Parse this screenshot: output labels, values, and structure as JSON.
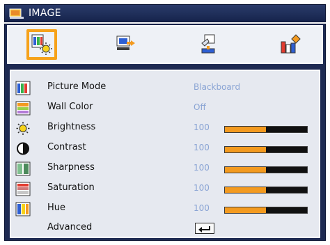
{
  "title": "IMAGE",
  "tabs": [
    {
      "icon": "image-settings-icon",
      "selected": true
    },
    {
      "icon": "display-settings-icon",
      "selected": false
    },
    {
      "icon": "setup-icon",
      "selected": false
    },
    {
      "icon": "options-icon",
      "selected": false
    }
  ],
  "rows": [
    {
      "label": "Picture Mode",
      "value": "Blackboard",
      "icon": "picture-mode-icon"
    },
    {
      "label": "Wall Color",
      "value": "Off",
      "icon": "wall-color-icon"
    },
    {
      "label": "Brightness",
      "value": "100",
      "level": 0.5,
      "icon": "brightness-icon"
    },
    {
      "label": "Contrast",
      "value": "100",
      "level": 0.5,
      "icon": "contrast-icon"
    },
    {
      "label": "Sharpness",
      "value": "100",
      "level": 0.5,
      "icon": "sharpness-icon"
    },
    {
      "label": "Saturation",
      "value": "100",
      "level": 0.5,
      "icon": "saturation-icon"
    },
    {
      "label": "Hue",
      "value": "100",
      "level": 0.5,
      "icon": "hue-icon"
    },
    {
      "label": "Advanced",
      "icon": "enter-icon"
    }
  ],
  "colors": {
    "accent": "#f39a1f",
    "panel": "#1e2a52",
    "value_text": "#8aa4d4"
  }
}
